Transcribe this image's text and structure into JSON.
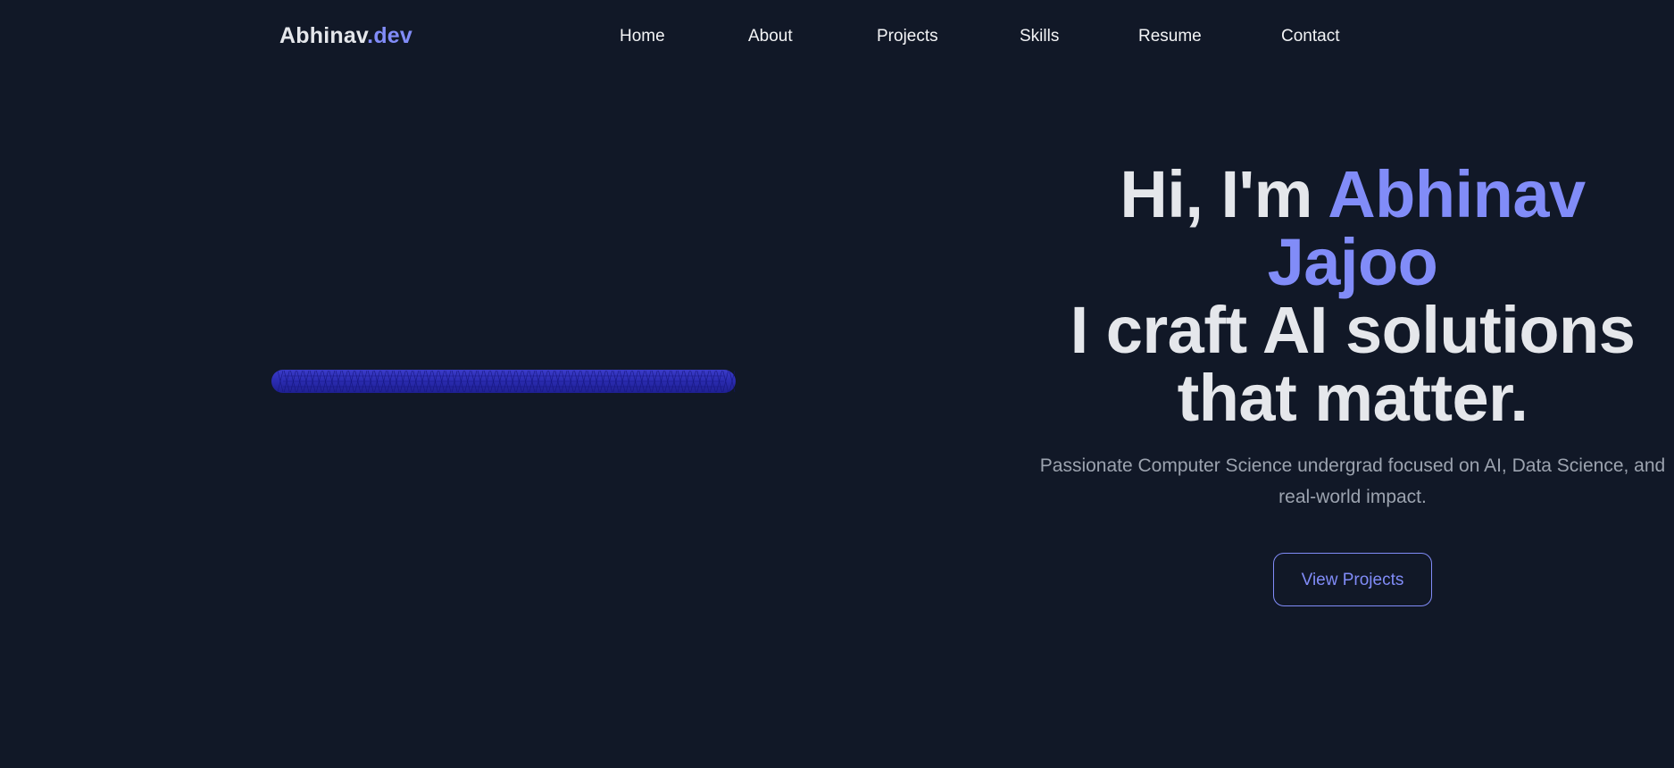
{
  "header": {
    "logo_main": "Abhinav",
    "logo_accent": ".dev",
    "nav": [
      {
        "label": "Home"
      },
      {
        "label": "About"
      },
      {
        "label": "Projects"
      },
      {
        "label": "Skills"
      },
      {
        "label": "Resume"
      },
      {
        "label": "Contact"
      }
    ]
  },
  "hero": {
    "greeting": "Hi, I'm ",
    "name_first": "Abhinav",
    "name_last": "Jajoo",
    "tagline_line1": "I craft AI solutions",
    "tagline_line2": "that matter.",
    "subtitle": "Passionate Computer Science undergrad focused on AI, Data Science, and real-world impact.",
    "cta_label": "View Projects"
  },
  "theme": {
    "background": "#111827",
    "accent": "#818cf8",
    "text": "#e5e7eb",
    "muted": "#9ca3af",
    "torus_color": "#2e2fb5"
  }
}
